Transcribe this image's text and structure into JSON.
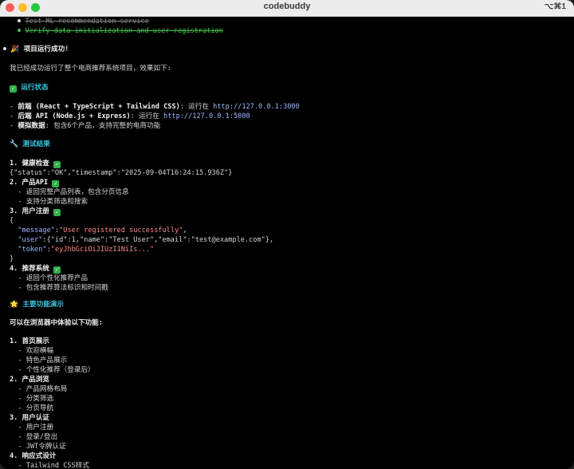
{
  "window": {
    "title": "codebuddy",
    "shortcut": "⌥⌘1"
  },
  "colors": {
    "section": "#35c8e0",
    "check": "#2fb14a",
    "url": "#9fb8ff",
    "string": "#ff8a8a"
  },
  "lines": {
    "l0": "Test ML recommendation service",
    "l1": "Verify data initialization and user registration",
    "l2": "项目运行成功!",
    "l3": "我已经成功运行了整个电商推荐系统项目，效果如下:",
    "l4": "运行状态",
    "l5a": "前端 (React + TypeScript + Tailwind CSS)",
    "l5b": ": 运行在 ",
    "l5c": "http://127.0.0.1:3000",
    "l6a": "后端 API (Node.js + Express)",
    "l6b": ": 运行在 ",
    "l6c": "http://127.0.0.1:5000",
    "l7a": "模拟数据",
    "l7b": ": 包含6个产品，支持完整的电商功能",
    "l8": "测试结果",
    "l9": "1. 健康检查",
    "l10": "{\"status\":\"OK\",\"timestamp\":\"2025-09-04T16:24:15.936Z\"}",
    "l11": "2. 产品API",
    "l12": "  - 返回完整产品列表，包含分页信息",
    "l13": "  - 支持分类筛选和搜索",
    "l14": "3. 用户注册",
    "l15": "{",
    "l16k": "\"message\"",
    "l16v": "\"User registered successfully\"",
    "l17k": "\"user\"",
    "l17m": ":{\"id\":1,\"name\":\"Test User\",\"email\":\"test@example.com\"},",
    "l18k": "\"token\"",
    "l18v": "\"eyJhbGciOiJIUzI1NiIs...\"",
    "l19": "}",
    "l20": "4. 推荐系统",
    "l21": "  - 返回个性化推荐产品",
    "l22": "  - 包含推荐算法标识和时间戳",
    "l23": "主要功能演示",
    "l24": "可以在浏览器中体验以下功能:",
    "l25": "1. 首页展示",
    "l26": "  - 欢迎横幅",
    "l27": "  - 特色产品展示",
    "l28": "  - 个性化推荐（登录后）",
    "l29": "2. 产品浏览",
    "l30": "  - 产品网格布局",
    "l31": "  - 分类筛选",
    "l32": "  - 分页导航",
    "l33": "3. 用户认证",
    "l34": "  - 用户注册",
    "l35": "  - 登录/登出",
    "l36": "  - JWT令牌认证",
    "l37": "4. 响应式设计",
    "l38": "  - Tailwind CSS样式"
  }
}
